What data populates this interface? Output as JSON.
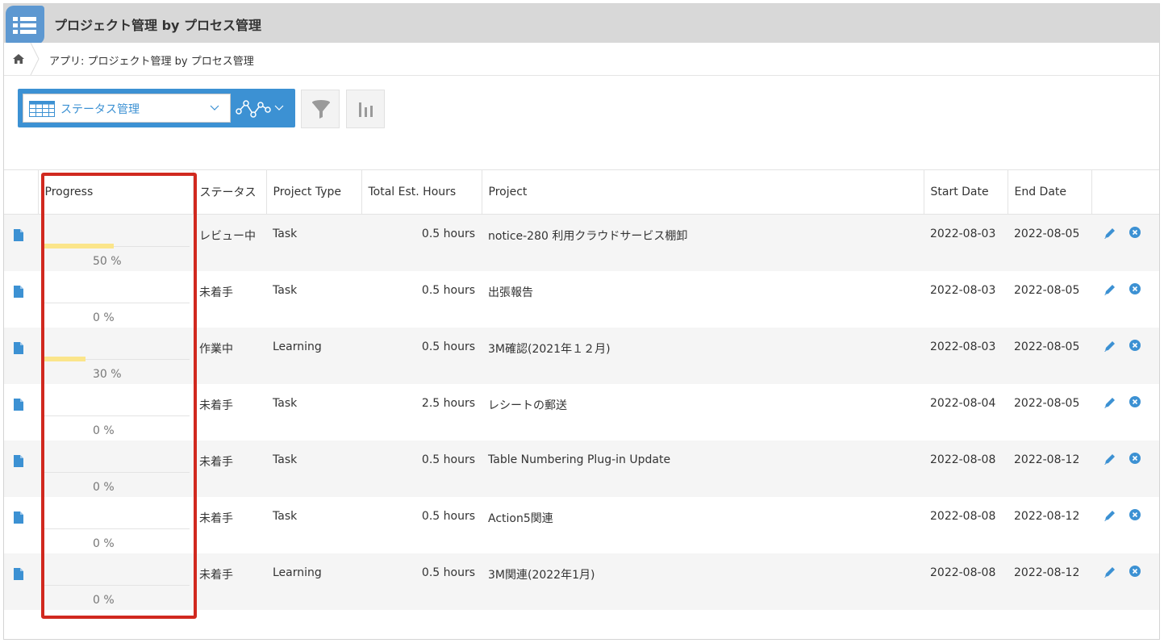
{
  "app": {
    "title": "プロジェクト管理 by プロセス管理",
    "icon": "app-list-icon"
  },
  "breadcrumb": {
    "home_icon": "home-icon",
    "text": "アプリ: プロジェクト管理 by プロセス管理"
  },
  "toolbar": {
    "view_label": "ステータス管理",
    "view_icon": "table-view-icon",
    "graph_icon": "graph-icon",
    "filter_icon": "filter-icon",
    "chart_icon": "bar-chart-icon",
    "accent_color": "#3c91d3"
  },
  "table": {
    "headers": [
      "Progress",
      "ステータス",
      "Project Type",
      "Total Est. Hours",
      "Project",
      "Start Date",
      "End Date"
    ],
    "rows": [
      {
        "progress": 0.5,
        "progress_label": "50 %",
        "status": "レビュー中",
        "type": "Task",
        "hours": "0.5 hours",
        "project": "notice-280 利用クラウドサービス棚卸",
        "start": "2022-08-03",
        "end": "2022-08-05"
      },
      {
        "progress": 0,
        "progress_label": "0 %",
        "status": "未着手",
        "type": "Task",
        "hours": "0.5 hours",
        "project": "出張報告",
        "start": "2022-08-03",
        "end": "2022-08-05"
      },
      {
        "progress": 0.3,
        "progress_label": "30 %",
        "status": "作業中",
        "type": "Learning",
        "hours": "0.5 hours",
        "project": "3M確認(2021年１２月)",
        "start": "2022-08-03",
        "end": "2022-08-05"
      },
      {
        "progress": 0,
        "progress_label": "0 %",
        "status": "未着手",
        "type": "Task",
        "hours": "2.5 hours",
        "project": "レシートの郵送",
        "start": "2022-08-04",
        "end": "2022-08-05"
      },
      {
        "progress": 0,
        "progress_label": "0 %",
        "status": "未着手",
        "type": "Task",
        "hours": "0.5 hours",
        "project": "Table Numbering Plug-in Update",
        "start": "2022-08-08",
        "end": "2022-08-12"
      },
      {
        "progress": 0,
        "progress_label": "0 %",
        "status": "未着手",
        "type": "Task",
        "hours": "0.5 hours",
        "project": "Action5関連",
        "start": "2022-08-08",
        "end": "2022-08-12"
      },
      {
        "progress": 0,
        "progress_label": "0 %",
        "status": "未着手",
        "type": "Learning",
        "hours": "0.5 hours",
        "project": "3M関連(2022年1月)",
        "start": "2022-08-08",
        "end": "2022-08-12"
      }
    ]
  },
  "colors": {
    "progress_fill": "#fbe58a",
    "highlight": "#d1291f",
    "row_alt": "#f5f5f5",
    "icon_blue": "#3c91d3"
  }
}
